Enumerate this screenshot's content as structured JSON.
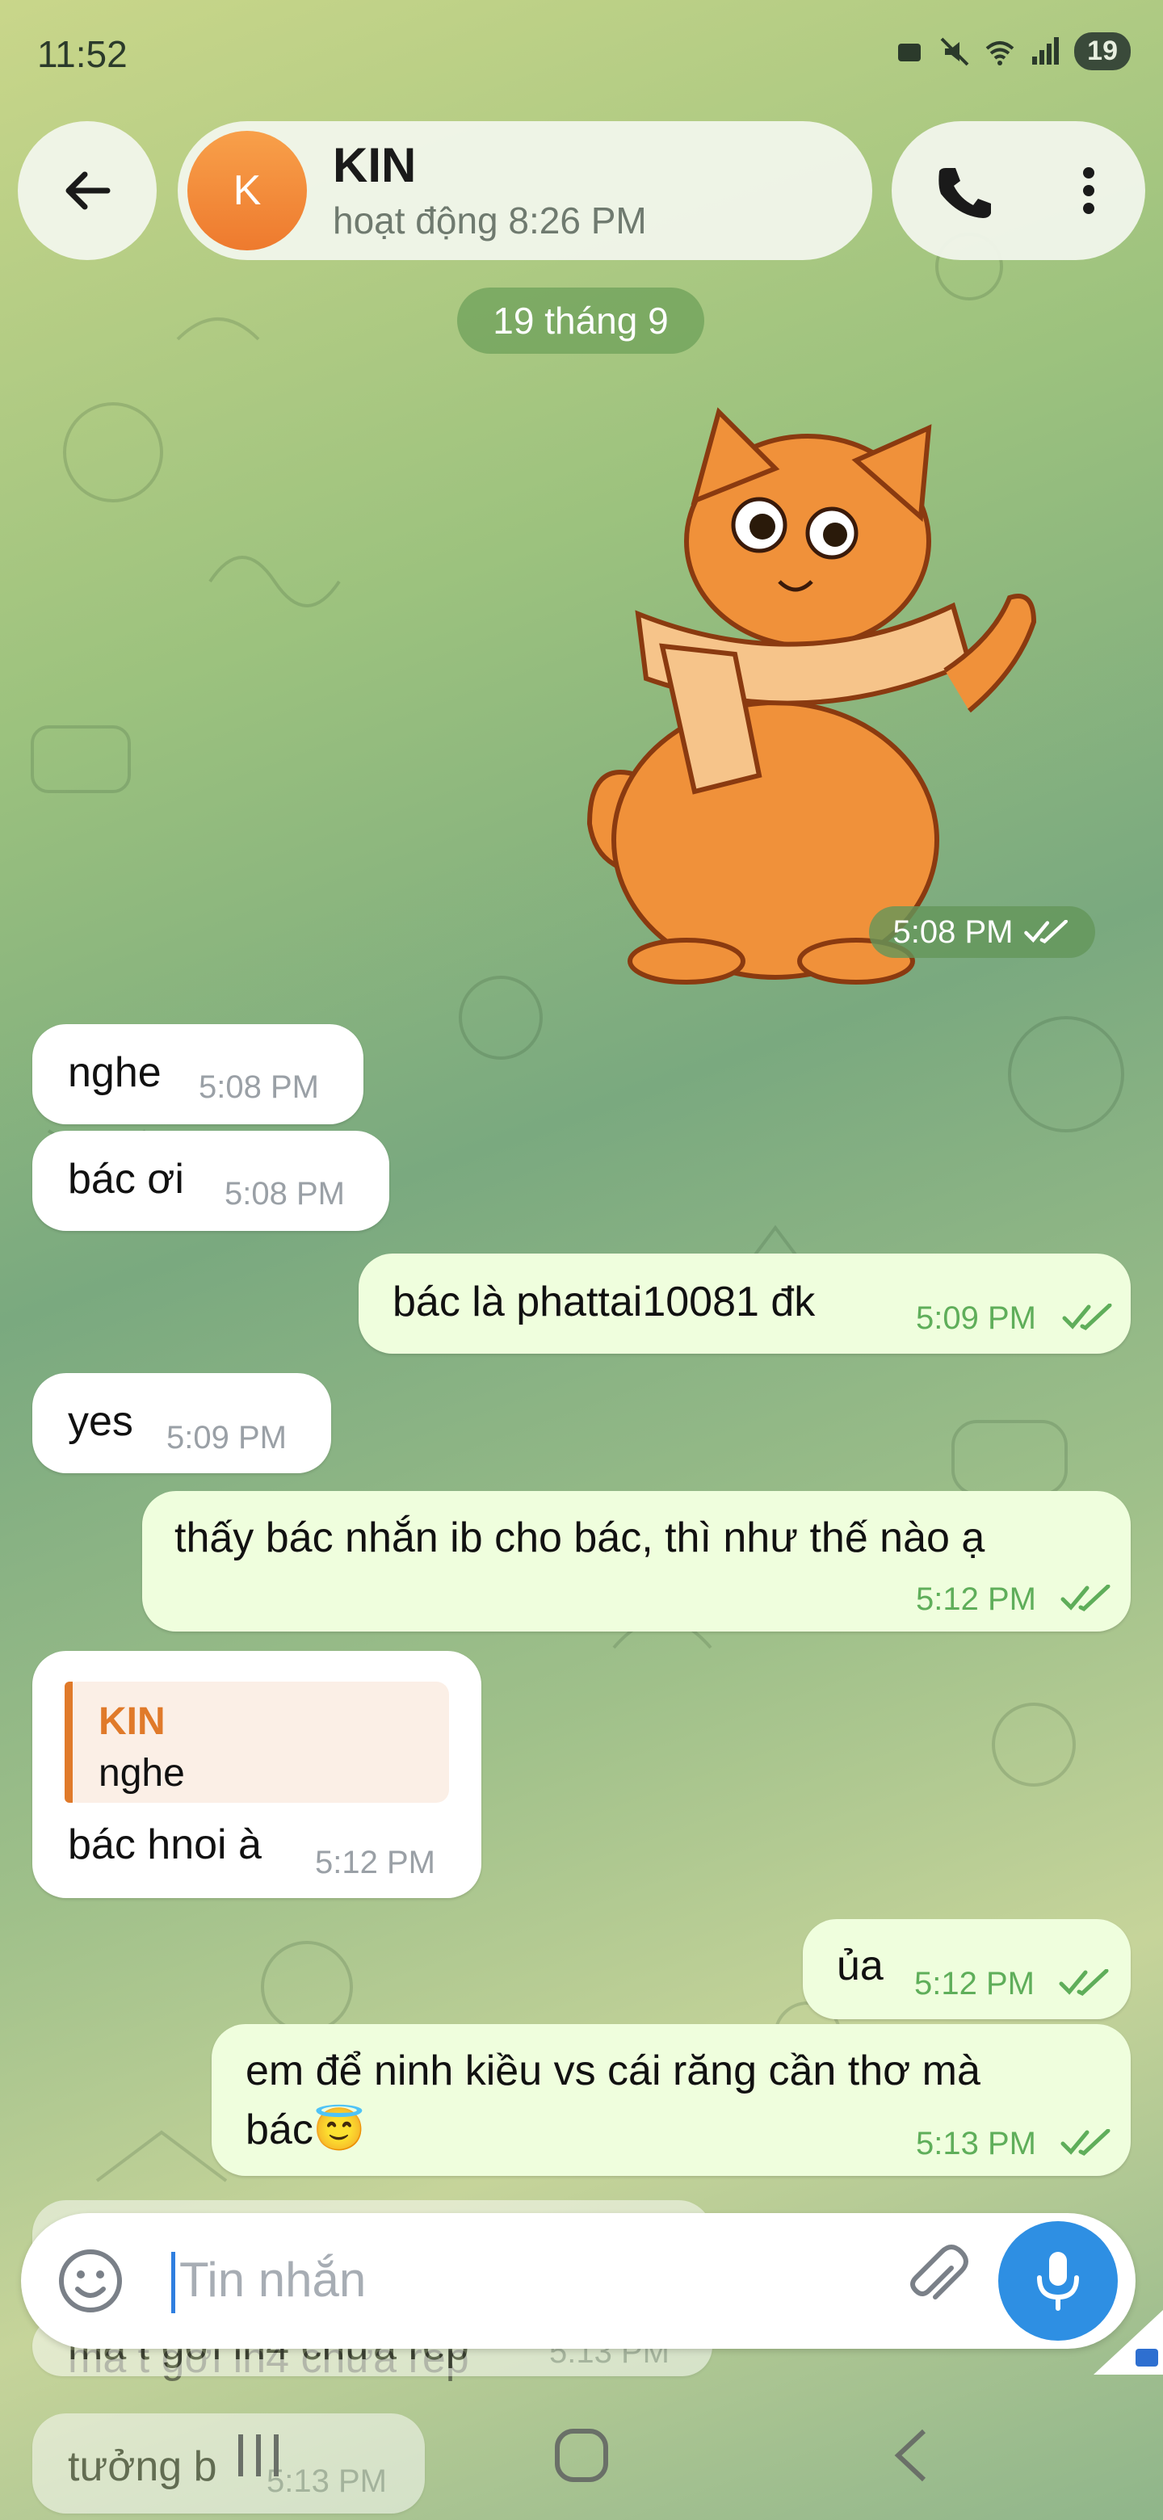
{
  "status_bar": {
    "time": "11:52",
    "battery": "19"
  },
  "header": {
    "avatar_initial": "K",
    "contact_name": "KIN",
    "contact_status": "hoạt động 8:26 PM",
    "icons": [
      "back-arrow-icon",
      "phone-icon",
      "more-vertical-icon"
    ]
  },
  "chat": {
    "date_chip": "19 tháng 9",
    "sticker": {
      "time": "5:08 PM",
      "description_icon": "orange-cat-sticker"
    },
    "messages": [
      {
        "dir": "in",
        "text": "nghe",
        "time": "5:08 PM"
      },
      {
        "dir": "in",
        "text": "bác ơi",
        "time": "5:08 PM"
      },
      {
        "dir": "out",
        "text": "bác là phattai10081 đk",
        "time": "5:09 PM"
      },
      {
        "dir": "in",
        "text": "yes",
        "time": "5:09 PM"
      },
      {
        "dir": "out",
        "text": "thấy bác nhắn ib cho bác, thì như thế nào ạ",
        "time": "5:12 PM"
      },
      {
        "dir": "in",
        "reply_name": "KIN",
        "reply_text": "nghe",
        "text": "bác hnoi à",
        "time": "5:12 PM"
      },
      {
        "dir": "out",
        "text": "ủa",
        "time": "5:12 PM"
      },
      {
        "dir": "out",
        "text_line1": "em để ninh kiều vs cái răng cần thơ mà",
        "text_line2": "bác😇",
        "time": "5:13 PM"
      },
      {
        "dir": "in",
        "text": "ma t gởi in4 chưa rep",
        "time": "5:13 PM"
      },
      {
        "dir": "in",
        "text": "tưởng b",
        "time": "5:13 PM"
      }
    ]
  },
  "composer": {
    "placeholder": "Tin nhắn"
  },
  "colors": {
    "accent": "#2e8fe3",
    "outgoing_bubble": "#effedd",
    "incoming_bubble": "#ffffff",
    "reply_accent": "#e07a2a",
    "tick_green": "#5fae5a"
  }
}
